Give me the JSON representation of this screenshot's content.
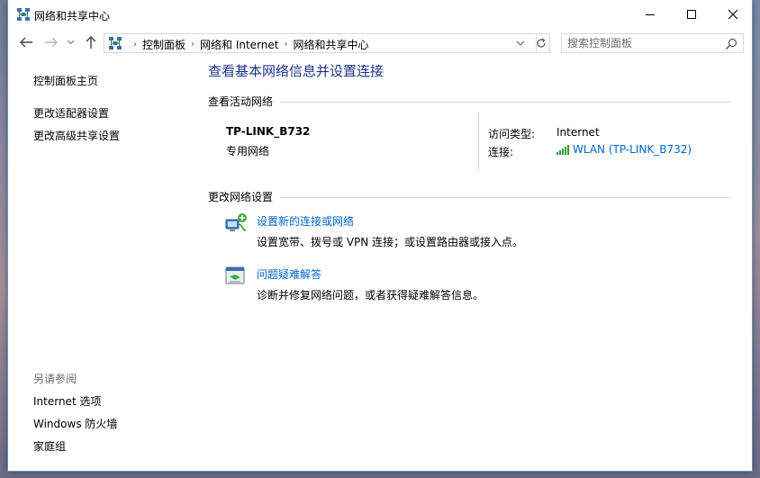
{
  "window": {
    "title": "网络和共享中心",
    "minimize_label": "Minimize",
    "maximize_label": "Maximize",
    "close_label": "Close"
  },
  "nav": {
    "breadcrumbs": [
      "控制面板",
      "网络和 Internet",
      "网络和共享中心"
    ],
    "search_placeholder": "搜索控制面板"
  },
  "sidebar": {
    "links": [
      "控制面板主页",
      "更改适配器设置",
      "更改高级共享设置"
    ],
    "see_also_header": "另请参阅",
    "see_also": [
      "Internet 选项",
      "Windows 防火墙",
      "家庭组"
    ]
  },
  "main": {
    "title": "查看基本网络信息并设置连接",
    "active_networks_header": "查看活动网络",
    "network": {
      "name": "TP-LINK_B732",
      "category": "专用网络",
      "access_type_label": "访问类型:",
      "access_type_value": "Internet",
      "connections_label": "连接:",
      "connection_value": "WLAN (TP-LINK_B732)"
    },
    "change_settings_header": "更改网络设置",
    "tasks": [
      {
        "link": "设置新的连接或网络",
        "description": "设置宽带、拨号或 VPN 连接；或设置路由器或接入点。",
        "icon": "new-connection-icon"
      },
      {
        "link": "问题疑难解答",
        "description": "诊断并修复网络问题，或者获得疑难解答信息。",
        "icon": "troubleshoot-icon"
      }
    ]
  },
  "colors": {
    "title_blue": "#1e3287",
    "link_blue": "#0066cc",
    "signal_green": "#2e9b2e"
  }
}
